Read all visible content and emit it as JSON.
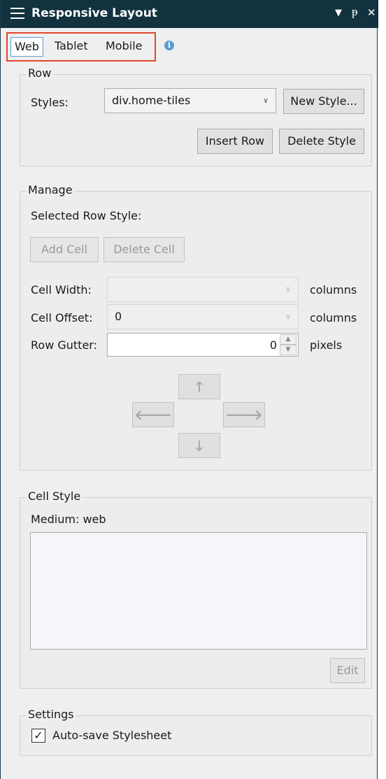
{
  "titlebar": {
    "title": "Responsive Layout",
    "icons": {
      "menu": "hamburger-icon",
      "dropdown": "▼",
      "pin": "ᵽ",
      "close": "✕"
    }
  },
  "tabs": [
    {
      "label": "Web",
      "active": true
    },
    {
      "label": "Tablet",
      "active": false
    },
    {
      "label": "Mobile",
      "active": false
    }
  ],
  "info_icon": "i",
  "row_group": {
    "label": "Row",
    "styles_label": "Styles:",
    "styles_value": "div.home-tiles",
    "new_style_button": "New Style...",
    "insert_row_button": "Insert Row",
    "delete_style_button": "Delete Style"
  },
  "manage_group": {
    "label": "Manage",
    "selected_row_style_label": "Selected Row Style:",
    "add_cell_button": "Add Cell",
    "delete_cell_button": "Delete Cell",
    "cell_width_label": "Cell Width:",
    "cell_width_value": "",
    "cell_width_unit": "columns",
    "cell_offset_label": "Cell Offset:",
    "cell_offset_value": "0",
    "cell_offset_unit": "columns",
    "row_gutter_label": "Row Gutter:",
    "row_gutter_value": "0",
    "row_gutter_unit": "pixels",
    "arrows": {
      "up": "🡑",
      "left": "🡐",
      "right": "🡒",
      "down": "🡓"
    }
  },
  "cell_style_group": {
    "label": "Cell Style",
    "medium_label": "Medium: web",
    "edit_button": "Edit"
  },
  "settings_group": {
    "label": "Settings",
    "autosave_label": "Auto-save Stylesheet",
    "autosave_checked": true
  },
  "colors": {
    "titlebar_bg": "#12323f",
    "tab_highlight_border": "#e0452f",
    "active_tab_border": "#5b9bd5"
  }
}
